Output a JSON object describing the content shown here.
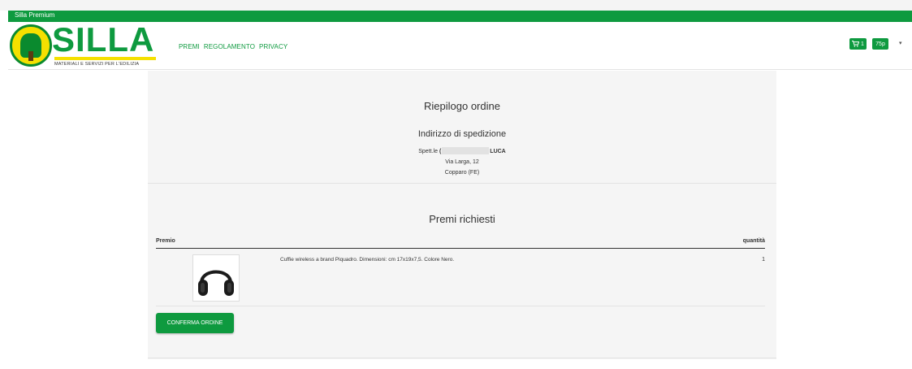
{
  "topbar": {
    "title": "Silla Premium"
  },
  "logo": {
    "word": "SILLA",
    "tagline": "MATERIALI E SERVIZI PER L'EDILIZIA"
  },
  "nav": {
    "items": [
      "PREMI",
      "REGOLAMENTO",
      "PRIVACY"
    ]
  },
  "header_actions": {
    "cart_count": "1",
    "points": "75p"
  },
  "summary": {
    "title": "Riepilogo ordine",
    "shipping_title": "Indirizzo di spedizione",
    "recipient_prefix": "Spett.le",
    "recipient_initial": "(",
    "recipient_suffix": "LUCA",
    "address_line1": "Via Larga, 12",
    "address_line2": "Copparo (FE)"
  },
  "prizes": {
    "title": "Premi richiesti",
    "columns": {
      "prize": "Premio",
      "quantity": "quantità"
    },
    "items": [
      {
        "description": "Cuffie wireless a brand Piquadro. Dimensioni: cm 17x19x7,5. Colore Nero.",
        "quantity": "1",
        "image_icon": "headphones-icon"
      }
    ]
  },
  "actions": {
    "confirm_label": "CONFERMA ORDINE"
  },
  "colors": {
    "brand_green": "#0e9a3f",
    "brand_yellow": "#f5e000"
  }
}
